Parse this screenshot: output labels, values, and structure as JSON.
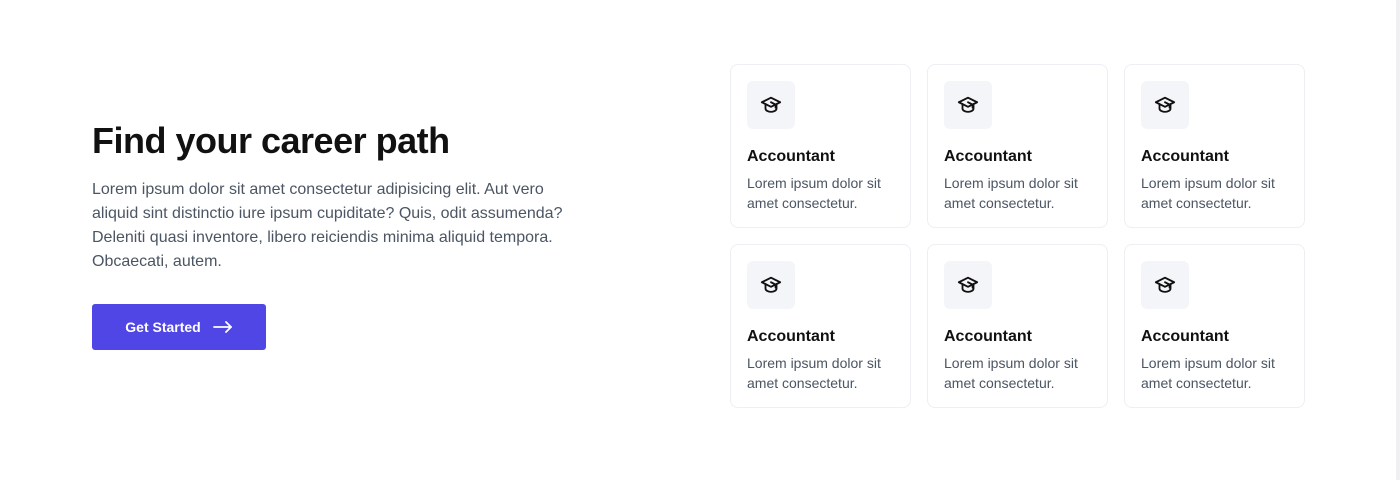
{
  "hero": {
    "title": "Find your career path",
    "description": "Lorem ipsum dolor sit amet consectetur adipisicing elit. Aut vero aliquid sint distinctio iure ipsum cupiditate? Quis, odit assumenda? Deleniti quasi inventore, libero reiciendis minima aliquid tempora. Obcaecati, autem.",
    "cta_label": "Get Started",
    "cta_icon": "arrow-right-icon"
  },
  "cards": [
    {
      "icon": "graduation-cap-icon",
      "title": "Accountant",
      "description": "Lorem ipsum dolor sit amet consectetur."
    },
    {
      "icon": "graduation-cap-icon",
      "title": "Accountant",
      "description": "Lorem ipsum dolor sit amet consectetur."
    },
    {
      "icon": "graduation-cap-icon",
      "title": "Accountant",
      "description": "Lorem ipsum dolor sit amet consectetur."
    },
    {
      "icon": "graduation-cap-icon",
      "title": "Accountant",
      "description": "Lorem ipsum dolor sit amet consectetur."
    },
    {
      "icon": "graduation-cap-icon",
      "title": "Accountant",
      "description": "Lorem ipsum dolor sit amet consectetur."
    },
    {
      "icon": "graduation-cap-icon",
      "title": "Accountant",
      "description": "Lorem ipsum dolor sit amet consectetur."
    }
  ],
  "colors": {
    "accent": "#4f46e5",
    "heading": "#111111",
    "body_text": "#4b5563",
    "card_border": "#eeeff2",
    "icon_bg": "#f4f5f8"
  }
}
